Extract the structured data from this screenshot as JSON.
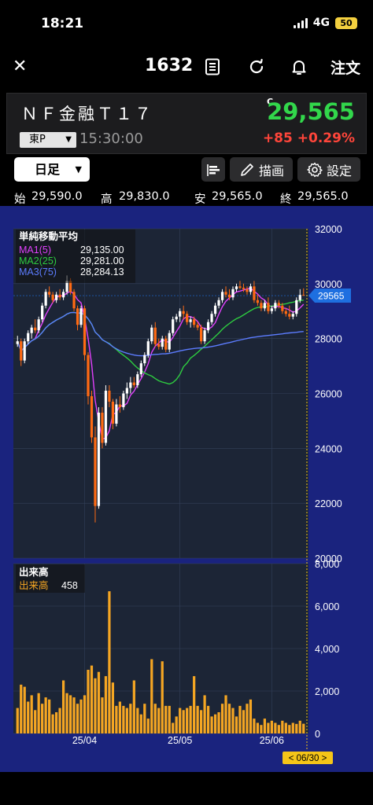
{
  "status_bar": {
    "time": "18:21",
    "network": "4G",
    "battery": "50"
  },
  "header": {
    "close_icon": "close-icon",
    "code": "1632",
    "order_label": "注文"
  },
  "quote": {
    "name": "ＮＦ金融Ｔ１７",
    "market": "東P",
    "time": "15:30:00",
    "flag": "C",
    "price": "29,565",
    "change": "+85",
    "change_pct": "+0.29%",
    "colors": {
      "up": "#32d74b",
      "change": "#ff453a"
    }
  },
  "toolbar": {
    "timeframe": "日足",
    "draw_label": "描画",
    "settings_label": "設定"
  },
  "ohlc": {
    "open_label": "始",
    "open": "29,590.0",
    "high_label": "高",
    "high": "29,830.0",
    "low_label": "安",
    "low": "29,565.0",
    "close_label": "終",
    "close": "29,565.0"
  },
  "chart_data": [
    {
      "type": "candlestick",
      "title": "単純移動平均",
      "legend": [
        {
          "name": "MA1(5)",
          "value": "29,135.00",
          "color": "#e040fb"
        },
        {
          "name": "MA2(25)",
          "value": "29,281.00",
          "color": "#2ecc40"
        },
        {
          "name": "MA3(75)",
          "value": "28,284.13",
          "color": "#5c7cff"
        }
      ],
      "y_ticks": [
        "32000",
        "30000",
        "28000",
        "26000",
        "24000",
        "22000",
        "20000"
      ],
      "ylim": [
        20000,
        32000
      ],
      "x_ticks": [
        "25/04",
        "25/05",
        "25/06"
      ],
      "last_price_label": "29565",
      "candles": [
        [
          27800,
          28100,
          27700,
          27900
        ],
        [
          27900,
          28000,
          27000,
          27200
        ],
        [
          27200,
          28000,
          27100,
          27900
        ],
        [
          27900,
          28300,
          27800,
          28200
        ],
        [
          28200,
          28500,
          28000,
          28400
        ],
        [
          28400,
          28700,
          28200,
          28300
        ],
        [
          28300,
          28800,
          28200,
          28700
        ],
        [
          28700,
          29300,
          28600,
          29200
        ],
        [
          29200,
          29800,
          29100,
          29700
        ],
        [
          29700,
          29900,
          29500,
          29600
        ],
        [
          29600,
          29700,
          29300,
          29400
        ],
        [
          29400,
          29700,
          29300,
          29600
        ],
        [
          29600,
          29800,
          29400,
          29500
        ],
        [
          29500,
          29800,
          29400,
          29700
        ],
        [
          29700,
          30300,
          29600,
          30100
        ],
        [
          30100,
          30200,
          29600,
          29700
        ],
        [
          29700,
          29800,
          29000,
          29100
        ],
        [
          29100,
          29200,
          28300,
          28500
        ],
        [
          28500,
          29200,
          28400,
          29100
        ],
        [
          29100,
          29200,
          27200,
          27400
        ],
        [
          27400,
          27500,
          25600,
          25900
        ],
        [
          25900,
          26100,
          24200,
          24400
        ],
        [
          24400,
          24800,
          21300,
          21900
        ],
        [
          21900,
          25500,
          21800,
          25300
        ],
        [
          25300,
          25500,
          24000,
          24200
        ],
        [
          24200,
          26300,
          24100,
          26100
        ],
        [
          26100,
          26300,
          25500,
          25700
        ],
        [
          25700,
          25800,
          24700,
          24900
        ],
        [
          24900,
          25800,
          24800,
          25600
        ],
        [
          25600,
          25900,
          25300,
          25500
        ],
        [
          25500,
          26100,
          25400,
          26000
        ],
        [
          26000,
          26400,
          25800,
          26200
        ],
        [
          26200,
          26600,
          26000,
          26400
        ],
        [
          26400,
          26600,
          26200,
          26300
        ],
        [
          26300,
          26800,
          26200,
          26700
        ],
        [
          26700,
          27200,
          26600,
          27100
        ],
        [
          27100,
          27500,
          27000,
          27400
        ],
        [
          27400,
          28000,
          27300,
          27900
        ],
        [
          27900,
          28500,
          27800,
          28400
        ],
        [
          28400,
          28600,
          27700,
          27800
        ],
        [
          27800,
          28000,
          27600,
          27700
        ],
        [
          27700,
          28100,
          27600,
          28000
        ],
        [
          28000,
          28100,
          27500,
          27600
        ],
        [
          27600,
          28300,
          27500,
          28200
        ],
        [
          28200,
          28800,
          28100,
          28700
        ],
        [
          28700,
          28900,
          28600,
          28800
        ],
        [
          28800,
          29100,
          28600,
          29000
        ],
        [
          29000,
          29200,
          28700,
          28900
        ],
        [
          28900,
          29000,
          28500,
          28600
        ],
        [
          28600,
          28800,
          28400,
          28700
        ],
        [
          28700,
          28800,
          28400,
          28500
        ],
        [
          28500,
          28600,
          28300,
          28400
        ],
        [
          28400,
          28500,
          27800,
          27900
        ],
        [
          27900,
          28400,
          27800,
          28300
        ],
        [
          28300,
          28700,
          28200,
          28600
        ],
        [
          28600,
          29000,
          28500,
          28900
        ],
        [
          28900,
          29300,
          28800,
          29200
        ],
        [
          29200,
          29500,
          29100,
          29400
        ],
        [
          29400,
          29800,
          29300,
          29700
        ],
        [
          29700,
          29900,
          29500,
          29600
        ],
        [
          29600,
          29800,
          29400,
          29500
        ],
        [
          29500,
          29900,
          29400,
          29800
        ],
        [
          29800,
          30000,
          29700,
          29900
        ],
        [
          29900,
          30100,
          29800,
          29850
        ],
        [
          29850,
          30000,
          29700,
          29800
        ],
        [
          29800,
          29900,
          29600,
          29700
        ],
        [
          29700,
          30000,
          29600,
          29900
        ],
        [
          29900,
          30100,
          29300,
          29400
        ],
        [
          29400,
          29600,
          29200,
          29300
        ],
        [
          29300,
          29400,
          29000,
          29100
        ],
        [
          29100,
          29400,
          29000,
          29300
        ],
        [
          29300,
          29500,
          28900,
          29000
        ],
        [
          29000,
          29200,
          28900,
          29100
        ],
        [
          29100,
          29400,
          29000,
          29300
        ],
        [
          29300,
          29400,
          29100,
          29200
        ],
        [
          29200,
          29300,
          28900,
          29000
        ],
        [
          29000,
          29100,
          28800,
          28900
        ],
        [
          28900,
          29200,
          28700,
          28800
        ],
        [
          28800,
          29000,
          28700,
          28900
        ],
        [
          28900,
          29500,
          28800,
          29400
        ],
        [
          29400,
          29800,
          29300,
          29590
        ],
        [
          29590,
          29830,
          29565,
          29565
        ]
      ]
    },
    {
      "type": "bar",
      "title": "出来高",
      "legend": [
        {
          "name": "出来高",
          "value": "458",
          "color": "#f5a623"
        }
      ],
      "y_ticks": [
        "8,000",
        "6,000",
        "4,000",
        "2,000",
        "0"
      ],
      "ylim": [
        0,
        8000
      ],
      "x_ticks": [
        "25/04",
        "25/05",
        "25/06"
      ],
      "date_tag": "< 06/30 >",
      "values": [
        1200,
        2300,
        2200,
        1500,
        1800,
        1100,
        1900,
        1400,
        1700,
        1600,
        900,
        1000,
        1200,
        2500,
        1900,
        1800,
        1700,
        1400,
        1600,
        1800,
        3000,
        3200,
        2600,
        2900,
        1700,
        2700,
        6700,
        2400,
        1300,
        1500,
        1300,
        1200,
        1400,
        2500,
        1200,
        900,
        1400,
        700,
        3500,
        1400,
        1200,
        3400,
        1300,
        1300,
        500,
        800,
        1200,
        1100,
        1200,
        1300,
        2700,
        1300,
        1100,
        1800,
        1300,
        800,
        900,
        1000,
        1400,
        1800,
        1400,
        1200,
        800,
        1300,
        1100,
        1400,
        1600,
        700,
        500,
        400,
        700,
        500,
        600,
        500,
        400,
        600,
        500,
        400,
        500,
        450,
        600,
        458
      ]
    }
  ]
}
